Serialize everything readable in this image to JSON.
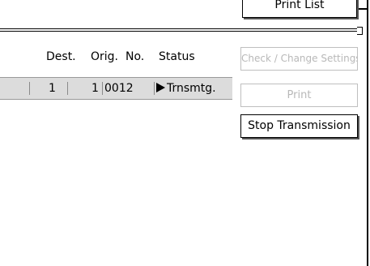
{
  "toolbar": {
    "print_list_label": "Print List"
  },
  "table": {
    "headers": {
      "dest": "Dest.",
      "orig": "Orig.",
      "no": "No.",
      "status": "Status"
    },
    "rows": [
      {
        "dest": "1",
        "orig": "1",
        "no": "0012",
        "status": "Trnsmtg.",
        "status_icon": "play-arrow-icon"
      }
    ]
  },
  "actions": {
    "check_change_label": "Check / Change Settings",
    "print_label": "Print",
    "stop_label": "Stop Transmission"
  },
  "colors": {
    "selected_row": "#dcdcdc",
    "disabled_text": "#b8b8b8"
  }
}
